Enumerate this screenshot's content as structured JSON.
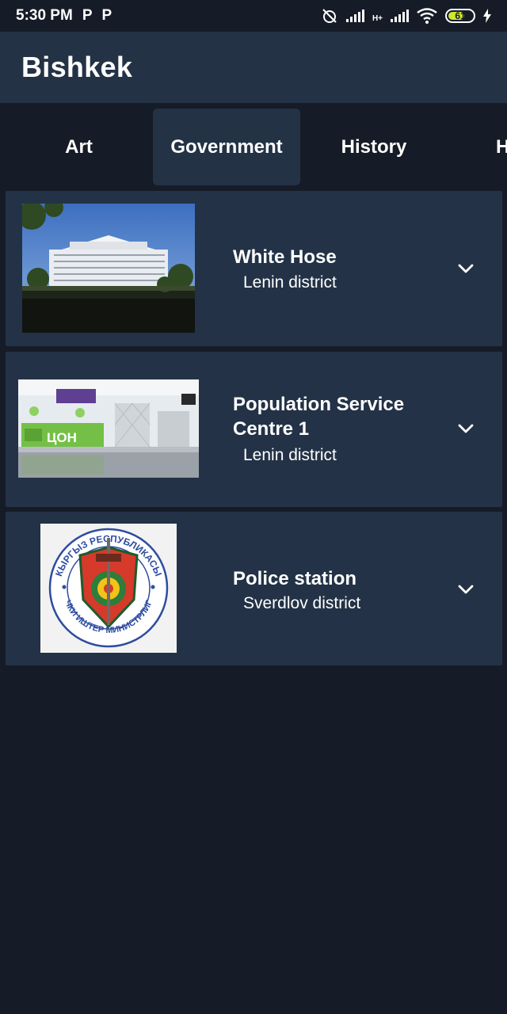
{
  "status_bar": {
    "time": "5:30 PM",
    "notif_icons": [
      "P",
      "P"
    ],
    "network": "H+",
    "battery_level": "61"
  },
  "app_bar": {
    "title": "Bishkek"
  },
  "tabs": [
    {
      "label": "Art",
      "active": false
    },
    {
      "label": "Government",
      "active": true
    },
    {
      "label": "History",
      "active": false
    },
    {
      "label": "H",
      "active": false
    }
  ],
  "places": [
    {
      "title": "White Hose",
      "district": "Lenin district",
      "icon": "chevron-down-icon"
    },
    {
      "title": "Population Service Centre 1",
      "district": "Lenin district",
      "icon": "chevron-down-icon"
    },
    {
      "title": "Police station",
      "district": "Sverdlov district",
      "icon": "chevron-down-icon"
    }
  ],
  "images": {
    "place_1_sign": "",
    "place_2_sign": "ЦОН",
    "place_3_emblem_top": "КЫРГЫЗ РЕСПУБЛИКАСЫ",
    "place_3_emblem_bottom": "ИЧКИ ИШТЕР МИНИСТРЛИГИ"
  },
  "colors": {
    "background": "#161c27",
    "surface": "#233246",
    "app_bar": "#243246",
    "text": "#ffffff"
  }
}
